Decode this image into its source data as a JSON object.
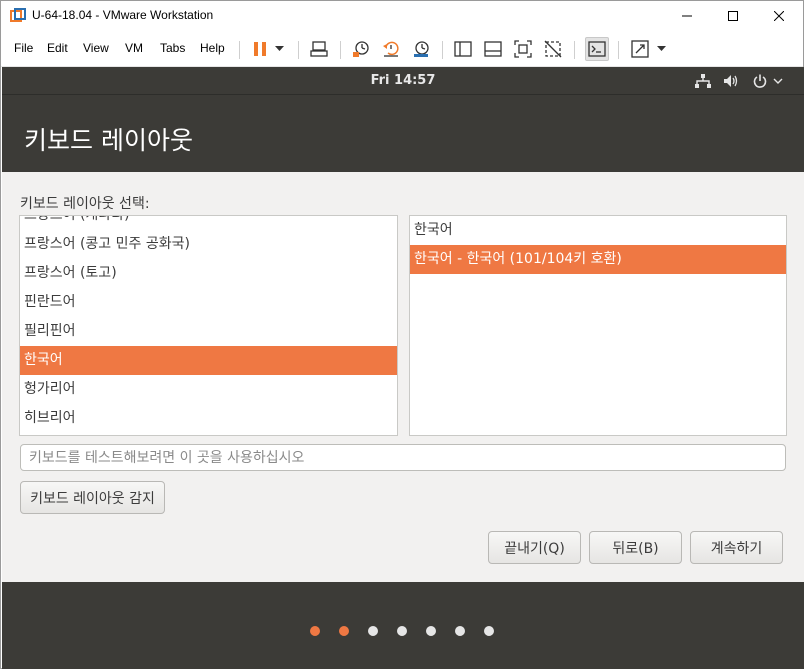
{
  "window": {
    "title": "U-64-18.04 - VMware Workstation"
  },
  "menubar": {
    "items": [
      "File",
      "Edit",
      "View",
      "VM",
      "Tabs",
      "Help"
    ]
  },
  "toolbar": {
    "icons": [
      "pause-icon",
      "dropdown-icon",
      "send-ctrl-alt-del-icon",
      "snapshot-icon",
      "revert-snapshot-icon",
      "snapshot-manager-icon",
      "library-icon",
      "thumbnail-bar-icon",
      "fullscreen-icon",
      "unity-icon",
      "console-view-icon",
      "stretch-guest-icon"
    ],
    "accent": "#f07a2a"
  },
  "ubuntu": {
    "clock": "Fri 14:57",
    "tray_icons": [
      "network-icon",
      "volume-icon",
      "power-icon",
      "chevron-down-icon"
    ]
  },
  "installer": {
    "title": "키보드 레이아웃",
    "section_label": "키보드 레이아웃 선택:",
    "layouts": [
      {
        "label": "프랑스어 (캐나다)",
        "selected": false
      },
      {
        "label": "프랑스어 (콩고 민주 공화국)",
        "selected": false
      },
      {
        "label": "프랑스어 (토고)",
        "selected": false
      },
      {
        "label": "핀란드어",
        "selected": false
      },
      {
        "label": "필리핀어",
        "selected": false
      },
      {
        "label": "한국어",
        "selected": true
      },
      {
        "label": "헝가리어",
        "selected": false
      },
      {
        "label": "히브리어",
        "selected": false
      }
    ],
    "variants": [
      {
        "label": "한국어",
        "selected": false
      },
      {
        "label": "한국어 - 한국어 (101/104키 호환)",
        "selected": true
      }
    ],
    "test_placeholder": "키보드를 테스트해보려면 이 곳을 사용하십시오",
    "detect_button": "키보드 레이아웃 감지",
    "quit_button": "끝내기(Q)",
    "back_button": "뒤로(B)",
    "continue_button": "계속하기",
    "progress": {
      "total_steps": 7,
      "completed_steps": 2
    },
    "accent_color": "#ef7843"
  }
}
